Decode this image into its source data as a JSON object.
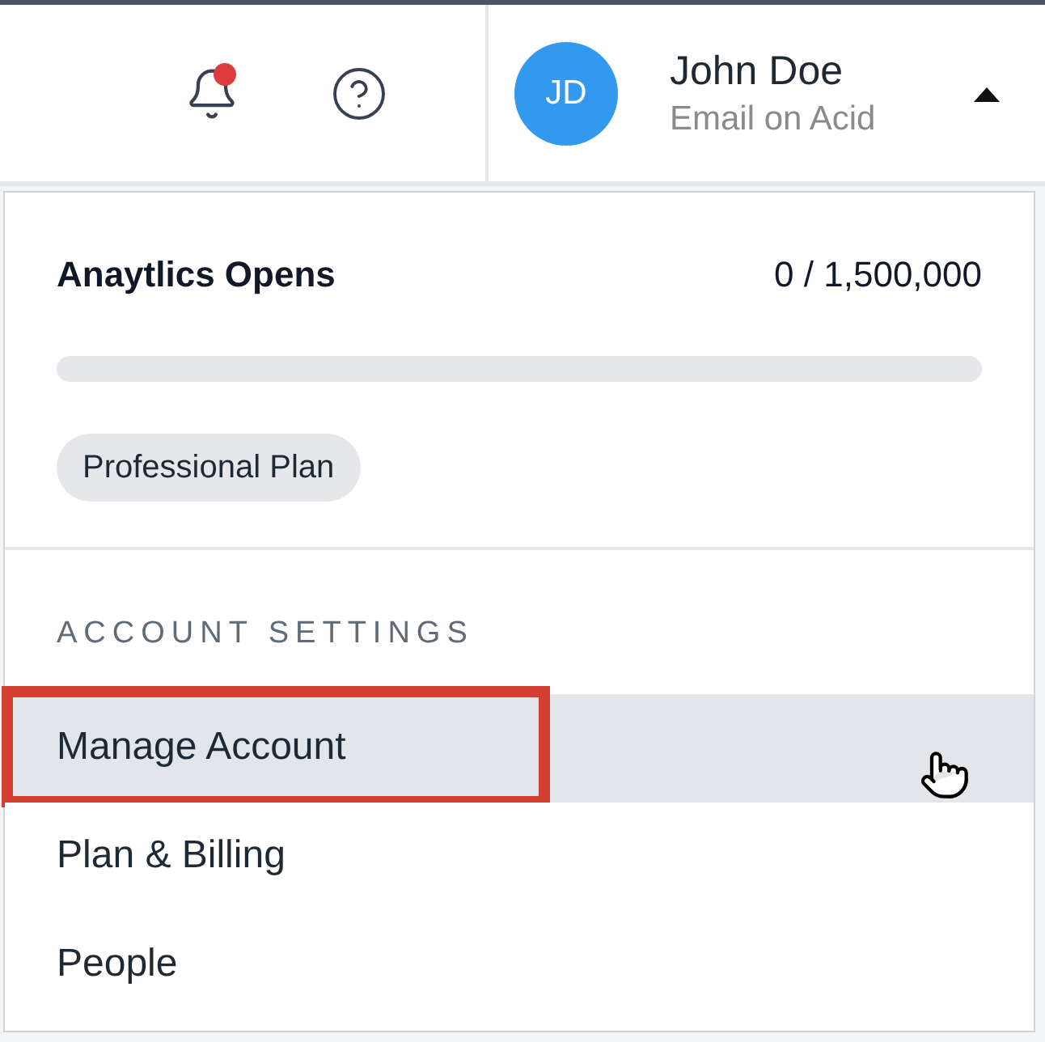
{
  "header": {
    "notifications": {
      "unread": true
    },
    "user": {
      "initials": "JD",
      "name": "John Doe",
      "company": "Email on Acid",
      "menu_open": true
    }
  },
  "dropdown": {
    "usage": {
      "label": "Anaytlics Opens",
      "reading": "0 / 1,500,000",
      "level": 0
    },
    "plan": "Professional Plan",
    "section_title": "ACCOUNT SETTINGS",
    "items": [
      {
        "label": "Manage Account",
        "selected": true,
        "outlined": true
      },
      {
        "label": "Plan & Billing",
        "selected": false,
        "outlined": false
      },
      {
        "label": "People",
        "selected": false,
        "outlined": false
      }
    ]
  }
}
